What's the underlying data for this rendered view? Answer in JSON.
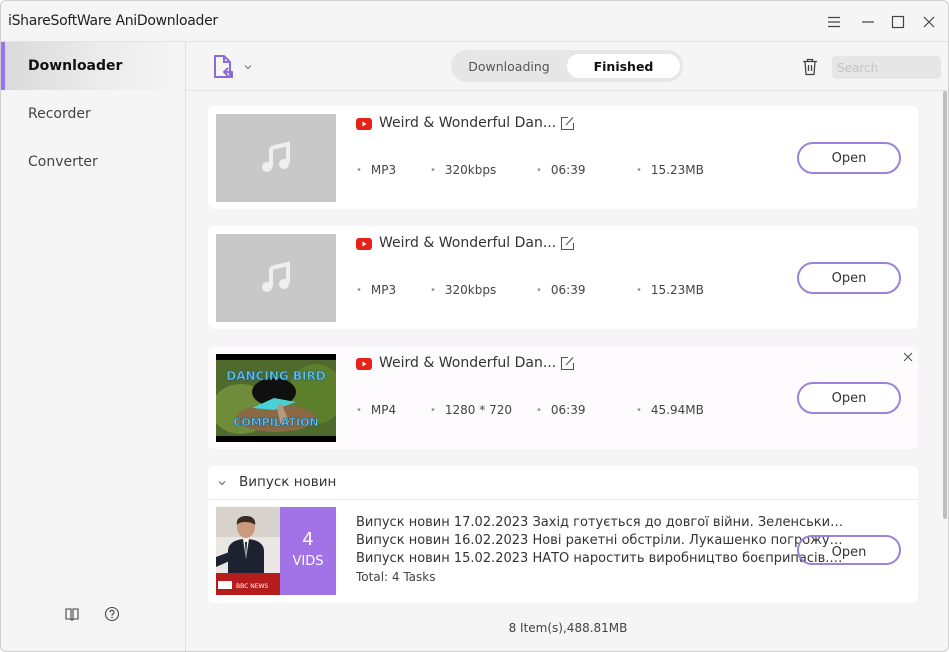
{
  "app": {
    "title": "iShareSoftWare AniDownloader"
  },
  "window_controls": [
    "menu-icon",
    "minimize-icon",
    "maximize-icon",
    "close-icon"
  ],
  "sidebar": {
    "items": [
      {
        "label": "Downloader",
        "active": true
      },
      {
        "label": "Recorder",
        "active": false
      },
      {
        "label": "Converter",
        "active": false
      }
    ],
    "footer_icons": [
      "book-icon",
      "help-icon"
    ]
  },
  "toolbar": {
    "tabs": [
      {
        "label": "Downloading",
        "active": false
      },
      {
        "label": "Finished",
        "active": true
      }
    ],
    "search_placeholder": "Search",
    "search_value": ""
  },
  "items": [
    {
      "source": "youtube",
      "title": "Weird & Wonderful Dan...",
      "format": "MP3",
      "quality": "320kbps",
      "duration": "06:39",
      "size": "15.23MB",
      "thumbnail": "music-note",
      "action": "Open"
    },
    {
      "source": "youtube",
      "title": "Weird & Wonderful Dan...",
      "format": "MP3",
      "quality": "320kbps",
      "duration": "06:39",
      "size": "15.23MB",
      "thumbnail": "music-note",
      "action": "Open"
    },
    {
      "source": "youtube",
      "title": "Weird & Wonderful Dan...",
      "format": "MP4",
      "quality": "1280 * 720",
      "duration": "06:39",
      "size": "45.94MB",
      "thumbnail": "DANCING BIRD COMPILATION",
      "thumb_top": "DANCING BIRD",
      "thumb_bottom": "COMPILATION",
      "action": "Open"
    }
  ],
  "group": {
    "title": "Випуск новин",
    "count": "4",
    "count_label": "VIDS",
    "thumb_caption": "BBC NEWS",
    "lines": [
      "Випуск новин 17.02.2023  Захід готується до довгої війни. Зеленський за...",
      "Випуск новин 16.02.2023 Нові ракетні обстріли. Лукашенко погрожує вій...",
      "Випуск новин 15.02.2023 НАТО наростить виробництво боєприпасів. У Т..."
    ],
    "total": "Total: 4 Tasks",
    "action": "Open"
  },
  "status": {
    "summary": "8 Item(s),488.81MB"
  },
  "colors": {
    "accent": "#9a74f0",
    "button_border": "#9c82d8",
    "youtube": "#e62117",
    "vids_badge": "#a273e6"
  }
}
